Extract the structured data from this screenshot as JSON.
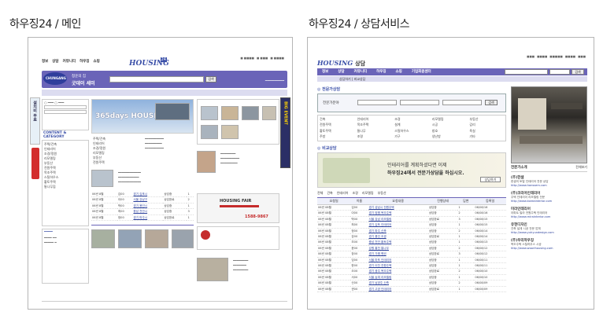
{
  "captions": {
    "left": "하우징24 / 메인",
    "right": "하우징24 / 상담서비스"
  },
  "left": {
    "nav": [
      "정보",
      "상담",
      "커뮤니티",
      "하우징",
      "쇼핑"
    ],
    "logo": "HOUSING",
    "logo_num": "24",
    "banner_brand": "CHUNGANG",
    "banner_title_small": "청운의 집",
    "banner_title": "굿데이 세미",
    "search_button": "검색",
    "side_ad": "설치비 무료",
    "side_right_ad": "BIG EVENT",
    "hero_title": "365days HOUSING FAIR",
    "section_title": "CONTENT & CATEGORY",
    "fair_banner": "HOUSING FAIR",
    "phone": "1588-9867",
    "left_items": [
      "주택/건축",
      "인테리어",
      "조경/정원",
      "리모델링",
      "부동산",
      "전원주택",
      "목조주택",
      "스틸하우스",
      "황토주택",
      "통나무집"
    ],
    "mid_list": [
      "주택/건축",
      "인테리어",
      "조경/정원",
      "리모델링",
      "부동산",
      "전원주택"
    ],
    "table_rows": [
      [
        "06년 8월",
        "김00",
        "경기 김포시",
        "상담중",
        "1"
      ],
      [
        "06년 8월",
        "이00",
        "서울 강남구",
        "상담완료",
        "2"
      ],
      [
        "06년 8월",
        "박00",
        "경기 용인시",
        "상담중",
        "1"
      ],
      [
        "06년 8월",
        "최00",
        "충남 천안시",
        "상담중",
        "3"
      ],
      [
        "06년 8월",
        "정00",
        "경기 파주시",
        "상담완료",
        "1"
      ]
    ]
  },
  "right": {
    "logo": "HOUSING",
    "logo_kor": "상담",
    "nav": [
      "정보",
      "상담",
      "커뮤니티",
      "하우징",
      "쇼핑",
      "기업회원센터"
    ],
    "search_button": "검색",
    "breadcrumb": "상담하기 | 비교상담",
    "section1": "전문가상담",
    "section2": "비교상담",
    "search_label": "전문가분야",
    "search_go": "검색",
    "categories": [
      "건축",
      "인테리어",
      "조경",
      "리모델링",
      "부동산",
      "전원주택",
      "목조주택",
      "설계",
      "시공",
      "감리",
      "황토주택",
      "통나무",
      "스틸하우스",
      "창호",
      "욕실",
      "주방",
      "조명",
      "가구",
      "냉난방",
      "기타"
    ],
    "promo_line1": "인테리어를 계획하셨다면 이제",
    "promo_line2": "하우징24에서 전문가상담을 하십시오.",
    "promo_button": "상담하기",
    "tabs": [
      "전체",
      "건축",
      "인테리어",
      "조경",
      "리모델링",
      "부동산"
    ],
    "table_headers": [
      "요청일",
      "이름",
      "요청내용",
      "진행상태",
      "답변",
      "등록일"
    ],
    "table_rows": [
      [
        "06년 08월",
        "김00",
        "경기 성남시 전원주택",
        "상담중",
        "1",
        "06/08/16"
      ],
      [
        "06년 08월",
        "이00",
        "경기 양평 목조주택",
        "상담중",
        "2",
        "06/08/16"
      ],
      [
        "06년 08월",
        "박00",
        "서울 강남 리모델링",
        "상담완료",
        "3",
        "06/08/15"
      ],
      [
        "06년 08월",
        "최00",
        "경기 김포 인테리어",
        "상담중",
        "1",
        "06/08/15"
      ],
      [
        "06년 08월",
        "정00",
        "경기 파주 신축",
        "상담중",
        "2",
        "06/08/14"
      ],
      [
        "06년 08월",
        "강00",
        "경기 용인 조경",
        "상담완료",
        "1",
        "06/08/14"
      ],
      [
        "06년 08월",
        "조00",
        "충남 천안 황토주택",
        "상담중",
        "1",
        "06/08/13"
      ],
      [
        "06년 08월",
        "윤00",
        "강원 홍천 통나무",
        "상담중",
        "2",
        "06/08/12"
      ],
      [
        "06년 08월",
        "장00",
        "경기 가평 펜션",
        "상담완료",
        "3",
        "06/08/12"
      ],
      [
        "06년 08월",
        "임00",
        "서울 마포 인테리어",
        "상담중",
        "1",
        "06/08/11"
      ],
      [
        "06년 08월",
        "한00",
        "경기 이천 전원주택",
        "상담중",
        "1",
        "06/08/11"
      ],
      [
        "06년 08월",
        "오00",
        "경기 광주 목조주택",
        "상담완료",
        "2",
        "06/08/10"
      ],
      [
        "06년 08월",
        "서00",
        "서울 송파 리모델링",
        "상담중",
        "1",
        "06/08/10"
      ],
      [
        "06년 08월",
        "신00",
        "경기 남양주 신축",
        "상담중",
        "2",
        "06/08/09"
      ],
      [
        "06년 08월",
        "권00",
        "경기 고양 인테리어",
        "상담완료",
        "1",
        "06/08/09"
      ]
    ],
    "photo_caption": "전문가소개",
    "photo_more": "전체보기",
    "experts": [
      {
        "name": "(주)한샘",
        "desc": "한샘의 토탈 인테리어 전문 상담",
        "url": "http://www.hanssem.com"
      },
      {
        "name": "(주)코리아인테리어",
        "desc": "주택 인테리어 리모델링 전문",
        "url": "http://www.koreainterior.com"
      },
      {
        "name": "미라인테리어",
        "desc": "아파트 빌라 전원주택 인테리어",
        "url": "http://www.mirainterior.com"
      },
      {
        "name": "유현디자인",
        "desc": "건축 설계 시공 전문 업체",
        "url": "http://www.yuhyundesign.com"
      },
      {
        "name": "(주)우리하우징",
        "desc": "목조주택 스틸하우스 시공",
        "url": "http://www.woorihousing.com"
      }
    ]
  },
  "colors": {
    "accent": "#6a64b8",
    "brand": "#3a4fa8"
  }
}
